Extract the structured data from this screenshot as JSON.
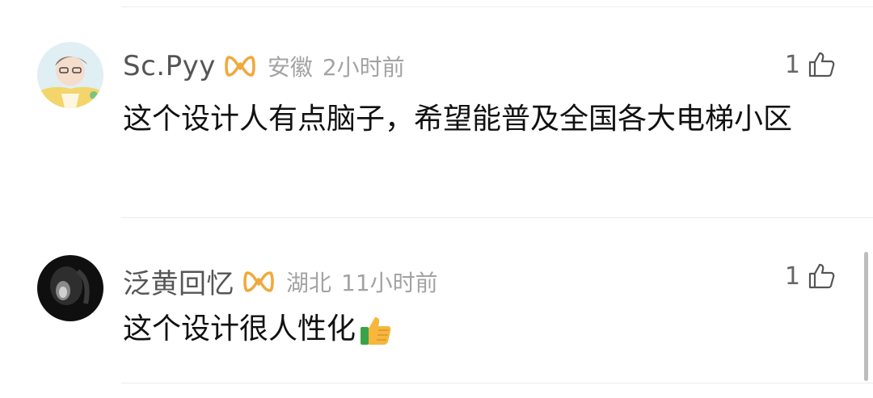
{
  "comments": [
    {
      "username": "Sc.Pyy",
      "location": "安徽",
      "time": "2小时前",
      "likes": "1",
      "text": "这个设计人有点脑子，希望能普及全国各大电梯小区"
    },
    {
      "username": "泛黄回忆",
      "location": "湖北",
      "time": "11小时前",
      "likes": "1",
      "text": "这个设计很人性化"
    }
  ],
  "colors": {
    "vip_badge": "#f0a93a",
    "meta_text": "#a3a3a3",
    "username": "#555555",
    "divider": "#ececec"
  },
  "icons": {
    "vip_badge": "vip-badge-icon",
    "like": "thumbs-up-outline-icon",
    "emoji": "thumbs-up-emoji"
  }
}
